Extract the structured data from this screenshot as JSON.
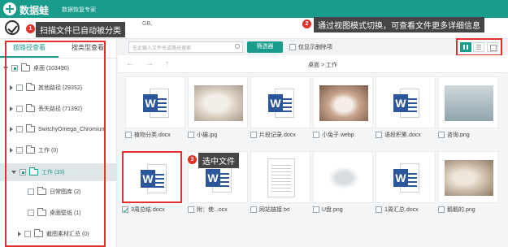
{
  "app": {
    "name": "数据蛙",
    "subtitle": "数据恢复专家"
  },
  "callouts": {
    "c1": {
      "num": "1",
      "text": "扫描文件已自动被分类"
    },
    "c2": {
      "num": "2",
      "text": "通过视图模式切换，可查看文件更多详细信息"
    },
    "c3": {
      "num": "3",
      "text": "选中文件"
    }
  },
  "gb_text": "GB,",
  "search": {
    "placeholder": "在此输入文件名或路径搜索"
  },
  "filter_button": "筛选器",
  "only_deleted": "仅显示删除项",
  "tabs": [
    "按路径查看",
    "按类型查看"
  ],
  "tree": [
    {
      "label": "桌面 (103490)"
    },
    {
      "label": "其他路径 (29352)"
    },
    {
      "label": "丢失路径 (71392)"
    },
    {
      "label": "SwitchyOmega_Chromium"
    },
    {
      "label": "工作 (0)"
    },
    {
      "label": "工作 (33)"
    },
    {
      "label": "日常图库 (2)"
    },
    {
      "label": "桌面壁纸 (1)"
    },
    {
      "label": "截图素材汇总 (0)"
    }
  ],
  "breadcrumb": "桌面 > 工作",
  "files_row1": [
    "植物分类.docx",
    "小猫.jpg",
    "片段记录.docx",
    "小兔子.webp",
    "语段积累.docx",
    "咨询.png"
  ],
  "files_row2": [
    "3周总结.docx",
    "附：使...ocx",
    "网站链接.txt",
    "U盘.png",
    "1周汇总.docx",
    "鹅鹅的.png"
  ],
  "colors": {
    "accent": "#1a9c8c",
    "callout_red": "#e2322b",
    "word_blue": "#2b579a"
  }
}
